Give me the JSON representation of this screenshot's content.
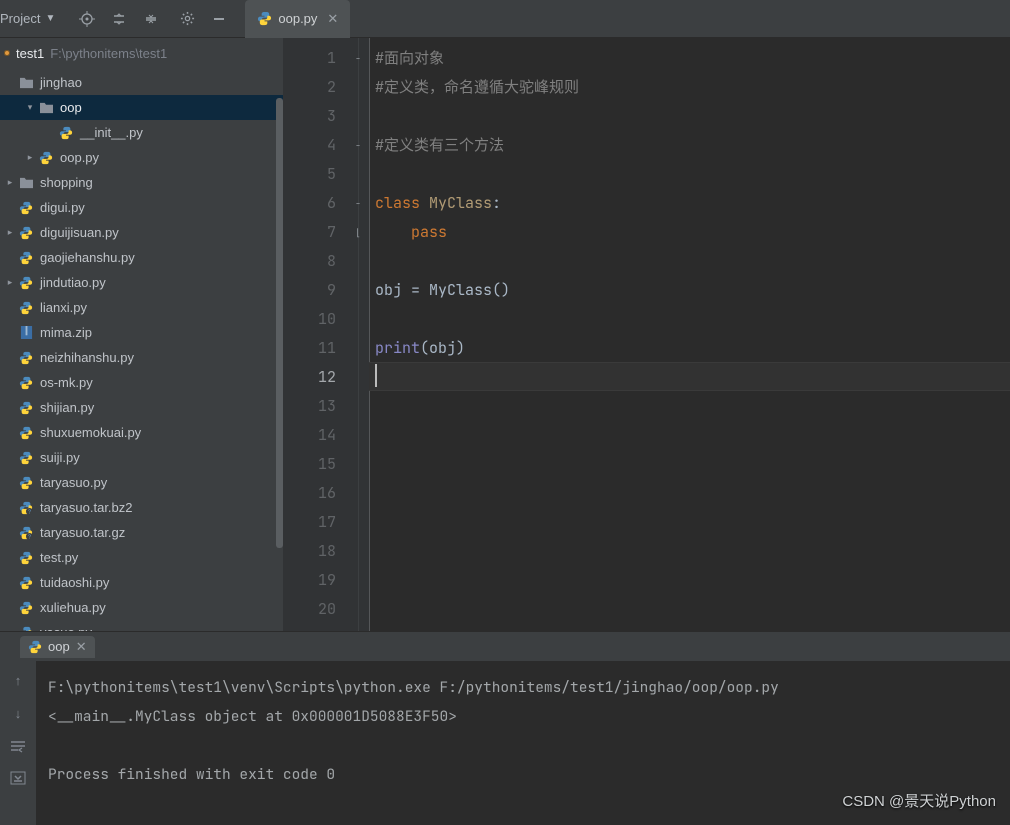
{
  "toolbar": {
    "project_label": "Project",
    "project_caret": "▼"
  },
  "tab": {
    "filename": "oop.py"
  },
  "crumb": {
    "root": "test1",
    "path": "F:\\pythonitems\\test1"
  },
  "tree": [
    {
      "depth": 0,
      "arrow": "",
      "icon": "folder",
      "label": "jinghao"
    },
    {
      "depth": 1,
      "arrow": "down",
      "icon": "folder",
      "label": "oop",
      "selected": true
    },
    {
      "depth": 2,
      "arrow": "",
      "icon": "py",
      "label": "__init__.py"
    },
    {
      "depth": 1,
      "arrow": "right",
      "icon": "py",
      "label": "oop.py"
    },
    {
      "depth": 0,
      "arrow": "right",
      "icon": "folder",
      "label": "shopping"
    },
    {
      "depth": 0,
      "arrow": "",
      "icon": "py",
      "label": "digui.py"
    },
    {
      "depth": 0,
      "arrow": "right",
      "icon": "py",
      "label": "diguijisuan.py"
    },
    {
      "depth": 0,
      "arrow": "",
      "icon": "py",
      "label": "gaojiehanshu.py"
    },
    {
      "depth": 0,
      "arrow": "right",
      "icon": "py",
      "label": "jindutiao.py"
    },
    {
      "depth": 0,
      "arrow": "",
      "icon": "py",
      "label": "lianxi.py"
    },
    {
      "depth": 0,
      "arrow": "",
      "icon": "zip",
      "label": "mima.zip"
    },
    {
      "depth": 0,
      "arrow": "",
      "icon": "py",
      "label": "neizhihanshu.py"
    },
    {
      "depth": 0,
      "arrow": "",
      "icon": "py",
      "label": "os-mk.py"
    },
    {
      "depth": 0,
      "arrow": "",
      "icon": "py",
      "label": "shijian.py"
    },
    {
      "depth": 0,
      "arrow": "",
      "icon": "py",
      "label": "shuxuemokuai.py"
    },
    {
      "depth": 0,
      "arrow": "",
      "icon": "py",
      "label": "suiji.py"
    },
    {
      "depth": 0,
      "arrow": "",
      "icon": "py",
      "label": "taryasuo.py"
    },
    {
      "depth": 0,
      "arrow": "",
      "icon": "arc",
      "label": "taryasuo.tar.bz2"
    },
    {
      "depth": 0,
      "arrow": "",
      "icon": "arc",
      "label": "taryasuo.tar.gz"
    },
    {
      "depth": 0,
      "arrow": "",
      "icon": "py",
      "label": "test.py"
    },
    {
      "depth": 0,
      "arrow": "",
      "icon": "py",
      "label": "tuidaoshi.py"
    },
    {
      "depth": 0,
      "arrow": "",
      "icon": "py",
      "label": "xuliehua.py"
    },
    {
      "depth": 0,
      "arrow": "",
      "icon": "py",
      "label": "yasuo.py"
    }
  ],
  "code": {
    "line_count": 20,
    "current_line": 12,
    "lines": [
      {
        "segs": [
          {
            "t": "#面向对象",
            "c": "cm"
          }
        ]
      },
      {
        "segs": [
          {
            "t": "#定义类，命名遵循大驼峰规则",
            "c": "cm"
          }
        ]
      },
      {
        "segs": []
      },
      {
        "segs": [
          {
            "t": "#定义类有三个方法",
            "c": "cm"
          }
        ]
      },
      {
        "segs": []
      },
      {
        "segs": [
          {
            "t": "class ",
            "c": "kw"
          },
          {
            "t": "MyClass",
            "c": "fn"
          },
          {
            "t": ":",
            "c": ""
          }
        ]
      },
      {
        "segs": [
          {
            "t": "    ",
            "c": ""
          },
          {
            "t": "pass",
            "c": "kw"
          }
        ]
      },
      {
        "segs": []
      },
      {
        "segs": [
          {
            "t": "obj = MyClass()",
            "c": ""
          }
        ]
      },
      {
        "segs": []
      },
      {
        "segs": [
          {
            "t": "print",
            "c": "bi"
          },
          {
            "t": "(obj)",
            "c": ""
          }
        ]
      },
      {
        "segs": []
      },
      {
        "segs": []
      }
    ],
    "fold_marks": {
      "1": "−",
      "4": "−",
      "6": "−",
      "7": "⌊"
    }
  },
  "run": {
    "tab_label": "oop",
    "lines": [
      "F:\\pythonitems\\test1\\venv\\Scripts\\python.exe F:/pythonitems/test1/jinghao/oop/oop.py",
      "<__main__.MyClass object at 0x000001D5088E3F50>",
      "",
      "Process finished with exit code 0"
    ]
  },
  "watermark": "CSDN @景天说Python"
}
